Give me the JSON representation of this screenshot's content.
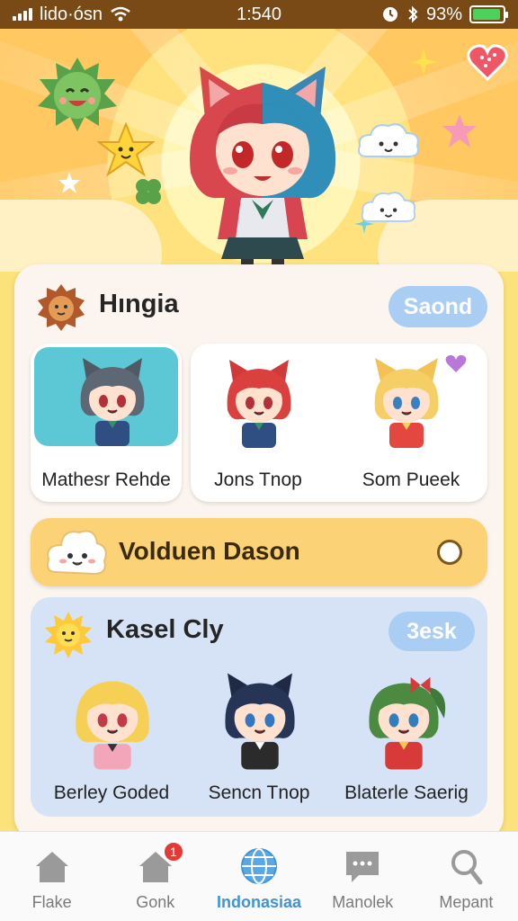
{
  "status_bar": {
    "carrier": "lido·ósn",
    "time": "1:540",
    "battery_percent": "93%",
    "battery_level": 0.93
  },
  "hero": {
    "character_icon": "anime-cat-girl-icon"
  },
  "section_one": {
    "title": "Hıngia",
    "button_label": "Saond",
    "characters": [
      {
        "name": "Mathesr Rehde",
        "icon": "gray-hair-cat-boy-icon",
        "highlighted": true
      },
      {
        "name": "Jons Tnop",
        "icon": "red-hair-cat-girl-icon",
        "highlighted": false
      },
      {
        "name": "Som Pueek",
        "icon": "blonde-fox-girl-icon",
        "highlighted": false
      }
    ]
  },
  "banner": {
    "title": "Volduen Dason",
    "icon": "cloud-face-icon"
  },
  "section_two": {
    "title": "Kasel Cly",
    "button_label": "3esk",
    "characters": [
      {
        "name": "Berley Goded",
        "icon": "blonde-girl-icon"
      },
      {
        "name": "Sencn Tnop",
        "icon": "navy-hair-cat-boy-icon"
      },
      {
        "name": "Blaterle Saerig",
        "icon": "green-hair-girl-icon"
      }
    ]
  },
  "nav": {
    "items": [
      {
        "label": "Flake",
        "icon": "home-icon",
        "active": false
      },
      {
        "label": "Gonk",
        "icon": "home-badge-icon",
        "active": false,
        "badge": "1"
      },
      {
        "label": "Indonasiaa",
        "icon": "globe-icon",
        "active": true
      },
      {
        "label": "Manolek",
        "icon": "chat-icon",
        "active": false
      },
      {
        "label": "Mepant",
        "icon": "search-icon",
        "active": false
      }
    ]
  },
  "colors": {
    "accent": "#3f93d8",
    "pill": "#a9cdf3",
    "banner": "#fcd276",
    "panel_blue": "#d6e3f6",
    "status_bar": "#7a4a16"
  }
}
